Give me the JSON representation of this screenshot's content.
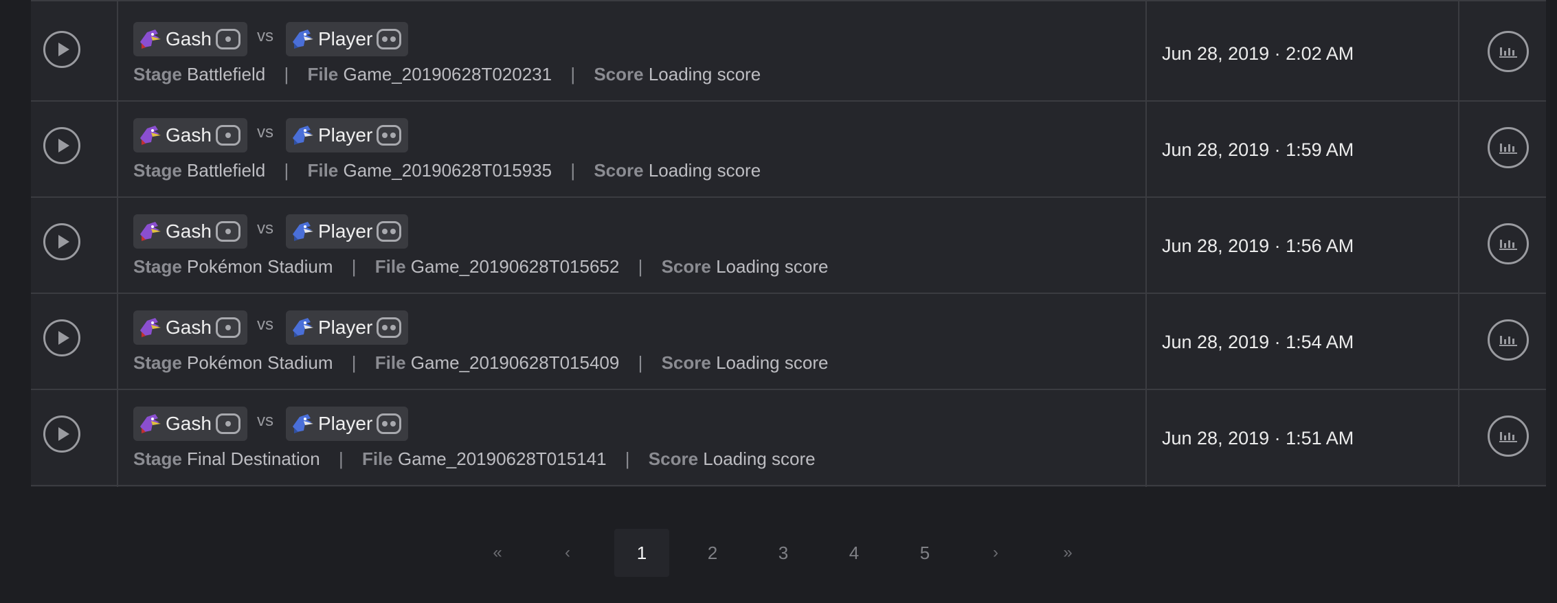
{
  "games": [
    {
      "player1": {
        "name": "Gash",
        "character_icon": "falco-icon",
        "port_icon": "port-dot-icon"
      },
      "vs": "vs",
      "player2": {
        "name": "Player",
        "character_icon": "falco-blue-icon",
        "port_icon": "port-two-dots-icon"
      },
      "stage_label": "Stage",
      "stage": "Battlefield",
      "file_label": "File",
      "file": "Game_20190628T020231",
      "score_label": "Score",
      "score": "Loading score",
      "date": "Jun 28, 2019 · 2:02 AM"
    },
    {
      "player1": {
        "name": "Gash",
        "character_icon": "falco-icon",
        "port_icon": "port-dot-icon"
      },
      "vs": "vs",
      "player2": {
        "name": "Player",
        "character_icon": "falco-blue-icon",
        "port_icon": "port-two-dots-icon"
      },
      "stage_label": "Stage",
      "stage": "Battlefield",
      "file_label": "File",
      "file": "Game_20190628T015935",
      "score_label": "Score",
      "score": "Loading score",
      "date": "Jun 28, 2019 · 1:59 AM"
    },
    {
      "player1": {
        "name": "Gash",
        "character_icon": "falco-icon",
        "port_icon": "port-dot-icon"
      },
      "vs": "vs",
      "player2": {
        "name": "Player",
        "character_icon": "falco-blue-icon",
        "port_icon": "port-two-dots-icon"
      },
      "stage_label": "Stage",
      "stage": "Pokémon Stadium",
      "file_label": "File",
      "file": "Game_20190628T015652",
      "score_label": "Score",
      "score": "Loading score",
      "date": "Jun 28, 2019 · 1:56 AM"
    },
    {
      "player1": {
        "name": "Gash",
        "character_icon": "falco-icon",
        "port_icon": "port-dot-icon"
      },
      "vs": "vs",
      "player2": {
        "name": "Player",
        "character_icon": "falco-blue-icon",
        "port_icon": "port-two-dots-icon"
      },
      "stage_label": "Stage",
      "stage": "Pokémon Stadium",
      "file_label": "File",
      "file": "Game_20190628T015409",
      "score_label": "Score",
      "score": "Loading score",
      "date": "Jun 28, 2019 · 1:54 AM"
    },
    {
      "player1": {
        "name": "Gash",
        "character_icon": "falco-icon",
        "port_icon": "port-dot-icon"
      },
      "vs": "vs",
      "player2": {
        "name": "Player",
        "character_icon": "falco-blue-icon",
        "port_icon": "port-two-dots-icon"
      },
      "stage_label": "Stage",
      "stage": "Final Destination",
      "file_label": "File",
      "file": "Game_20190628T015141",
      "score_label": "Score",
      "score": "Loading score",
      "date": "Jun 28, 2019 · 1:51 AM"
    }
  ],
  "pagination": {
    "first": "«",
    "prev": "‹",
    "pages": [
      "1",
      "2",
      "3",
      "4",
      "5"
    ],
    "active": "1",
    "next": "›",
    "last": "»"
  },
  "colors": {
    "background": "#1d1e22",
    "table": "#25262b",
    "border": "#3b3c41",
    "tag": "#3a3b40"
  }
}
